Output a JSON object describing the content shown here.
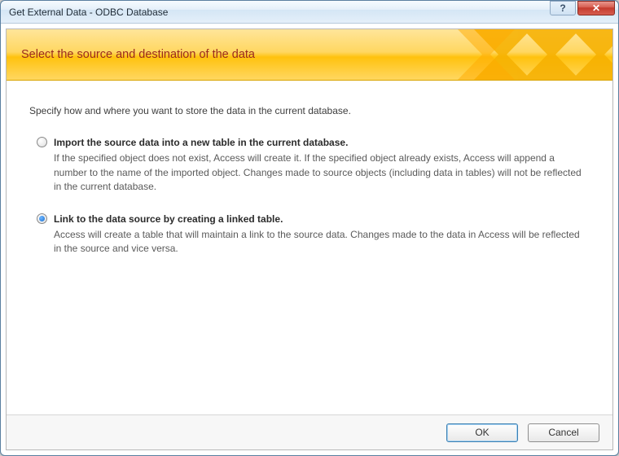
{
  "titlebar": {
    "title": "Get External Data - ODBC Database"
  },
  "banner": {
    "heading": "Select the source and destination of the data"
  },
  "body": {
    "intro": "Specify how and where you want to store the data in the current database.",
    "options": {
      "import": {
        "selected": false,
        "title": "Import the source data into a new table in the current database.",
        "desc": "If the specified object does not exist, Access will create it. If the specified object already exists, Access will append a number to the name of the imported object. Changes made to source objects (including data in tables) will not be reflected in the current database."
      },
      "link": {
        "selected": true,
        "title": "Link to the data source by creating a linked table.",
        "desc": "Access will create a table that will maintain a link to the source data. Changes made to the data in Access will be reflected in the source and vice versa."
      }
    }
  },
  "footer": {
    "ok": "OK",
    "cancel": "Cancel"
  }
}
